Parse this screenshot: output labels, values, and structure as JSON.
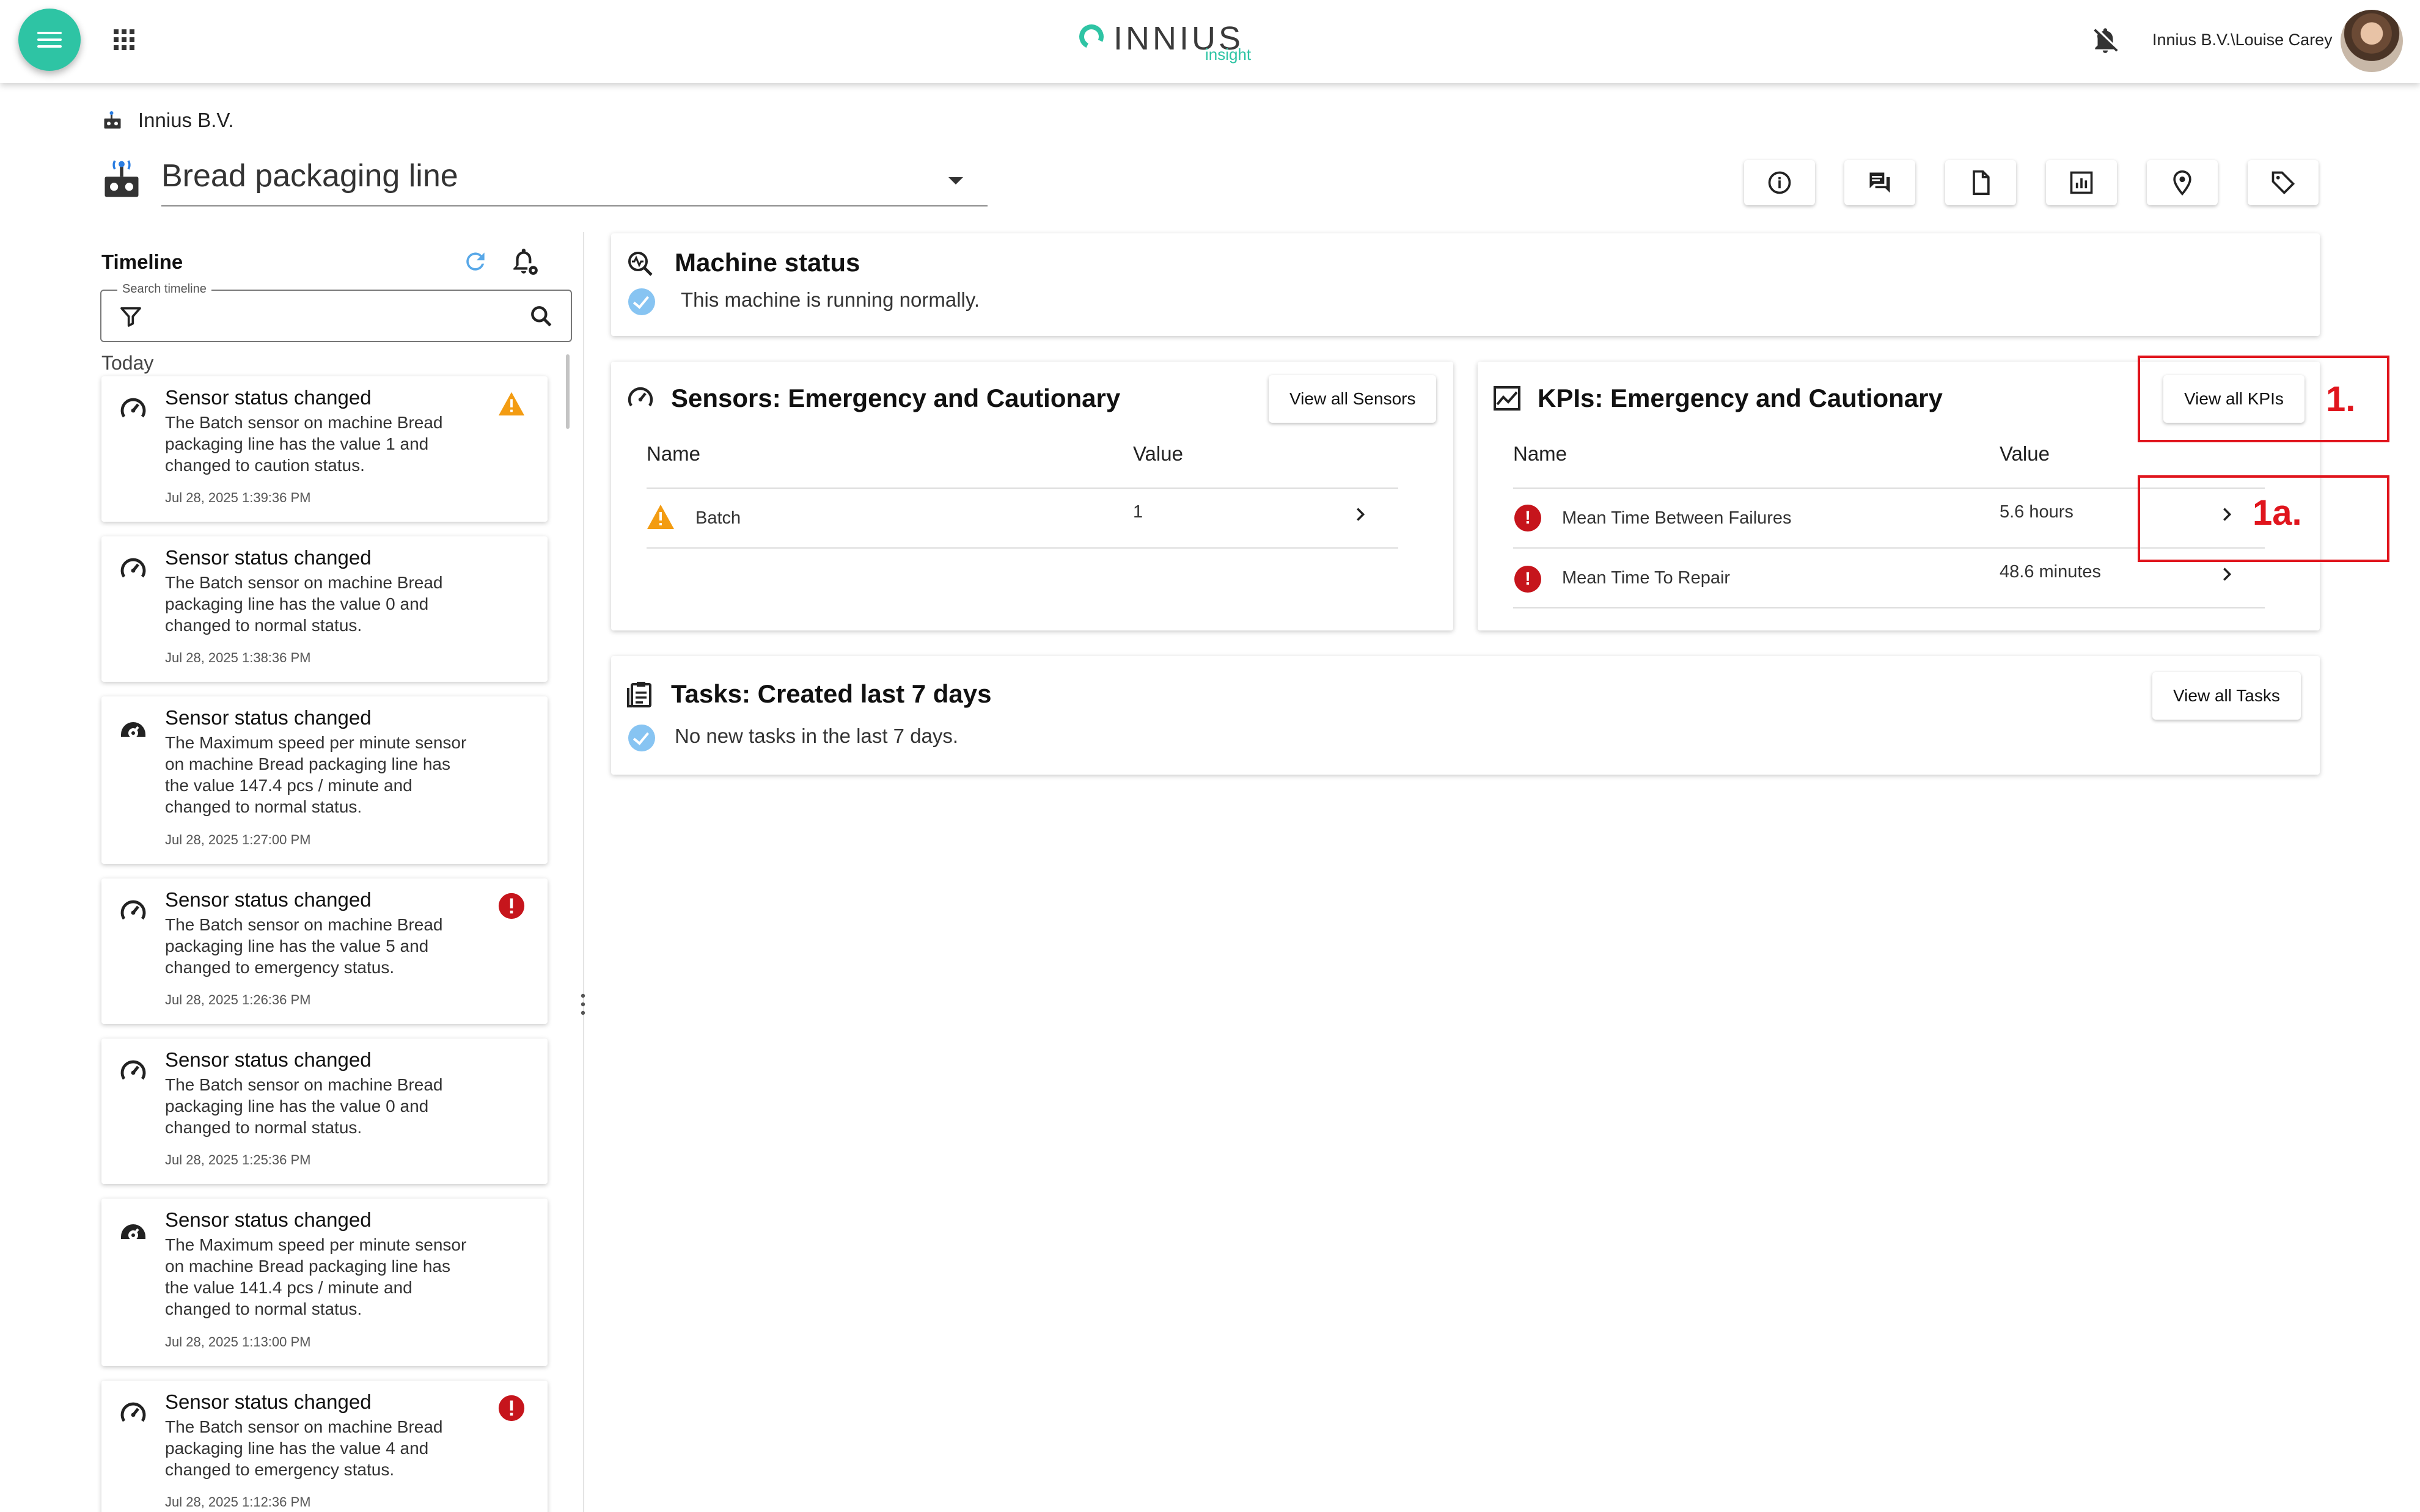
{
  "header": {
    "logo_text": "INNIUS",
    "logo_sub": "insight",
    "user": "Innius B.V.\\Louise Carey"
  },
  "breadcrumb": {
    "org": "Innius B.V."
  },
  "machine": {
    "name": "Bread packaging line"
  },
  "timeline": {
    "title": "Timeline",
    "search_legend": "Search timeline",
    "search_value": "",
    "group_label": "Today",
    "items": [
      {
        "title": "Sensor status changed",
        "body": "The Batch sensor on machine Bread packaging line has the value 1 and changed to caution status.",
        "time": "Jul 28, 2025 1:39:36 PM",
        "icon": "gauge-icon",
        "status": "caution"
      },
      {
        "title": "Sensor status changed",
        "body": "The Batch sensor on machine Bread packaging line has the value 0 and changed to normal status.",
        "time": "Jul 28, 2025 1:38:36 PM",
        "icon": "gauge-icon",
        "status": "normal"
      },
      {
        "title": "Sensor status changed",
        "body": "The Maximum speed per minute sensor on machine Bread packaging line has the value 147.4 pcs / minute and changed to normal status.",
        "time": "Jul 28, 2025 1:27:00 PM",
        "icon": "speedometer-icon",
        "status": "normal"
      },
      {
        "title": "Sensor status changed",
        "body": "The Batch sensor on machine Bread packaging line has the value 5 and changed to emergency status.",
        "time": "Jul 28, 2025 1:26:36 PM",
        "icon": "gauge-icon",
        "status": "emergency"
      },
      {
        "title": "Sensor status changed",
        "body": "The Batch sensor on machine Bread packaging line has the value 0 and changed to normal status.",
        "time": "Jul 28, 2025 1:25:36 PM",
        "icon": "gauge-icon",
        "status": "normal"
      },
      {
        "title": "Sensor status changed",
        "body": "The Maximum speed per minute sensor on machine Bread packaging line has the value 141.4 pcs / minute and changed to normal status.",
        "time": "Jul 28, 2025 1:13:00 PM",
        "icon": "speedometer-icon",
        "status": "normal"
      },
      {
        "title": "Sensor status changed",
        "body": "The Batch sensor on machine Bread packaging line has the value 4 and changed to emergency status.",
        "time": "Jul 28, 2025 1:12:36 PM",
        "icon": "gauge-icon",
        "status": "emergency"
      }
    ]
  },
  "machine_status": {
    "title": "Machine status",
    "text": "This machine is running normally."
  },
  "sensors": {
    "title": "Sensors: Emergency and Cautionary",
    "button": "View all Sensors",
    "col_name": "Name",
    "col_value": "Value",
    "rows": [
      {
        "name": "Batch",
        "value": "1",
        "status": "caution"
      }
    ]
  },
  "kpis": {
    "title": "KPIs: Emergency and Cautionary",
    "button": "View all KPIs",
    "col_name": "Name",
    "col_value": "Value",
    "rows": [
      {
        "name": "Mean Time Between Failures",
        "value": "5.6 hours",
        "status": "emergency"
      },
      {
        "name": "Mean Time To Repair",
        "value": "48.6 minutes",
        "status": "emergency"
      }
    ]
  },
  "tasks": {
    "title": "Tasks: Created last 7 days",
    "button": "View all Tasks",
    "text": "No new tasks in the last 7 days."
  },
  "annotations": {
    "a1": "1.",
    "a1a": "1a."
  },
  "colors": {
    "accent": "#2ec4a4",
    "emergency": "#c6151c",
    "caution": "#f39c12",
    "check": "#87c4f2",
    "annotation": "#e0151d"
  }
}
